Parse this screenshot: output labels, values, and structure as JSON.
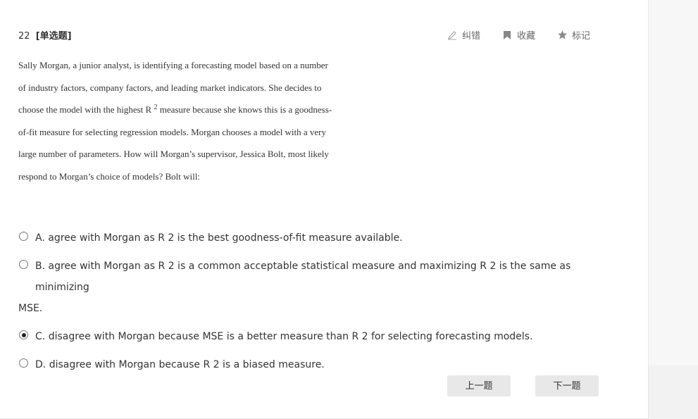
{
  "question": {
    "number": "22",
    "type": "[单选题]",
    "stem_lines": [
      "Sally Morgan, a junior analyst, is identifying a forecasting model based on a number",
      "of industry factors, company factors, and leading market indicators. She decides to",
      "choose the model with the highest R ",
      "2",
      " measure because she knows this is a goodness-",
      "of-fit measure for selecting regression models. Morgan chooses a model with a very",
      "large number of parameters. How will Morgan’s supervisor, Jessica Bolt, most likely",
      "respond to Morgan’s choice of models? Bolt will:"
    ]
  },
  "toolbar": {
    "correct_label": "纠错",
    "favorite_label": "收藏",
    "mark_label": "标记"
  },
  "options": [
    {
      "letter": "A.",
      "text": "agree with Morgan as R 2 is the best goodness-of-fit measure available.",
      "selected": false
    },
    {
      "letter": "B.",
      "text": "agree with Morgan as R 2 is a common acceptable statistical measure and maximizing R 2 is the same as minimizing",
      "text_cont": "MSE.",
      "selected": false
    },
    {
      "letter": "C.",
      "text": "disagree with Morgan because MSE is a better measure than R 2 for selecting forecasting models.",
      "selected": true
    },
    {
      "letter": "D.",
      "text": "disagree with Morgan because R 2 is a biased measure.",
      "selected": false
    }
  ],
  "nav": {
    "prev_label": "上一题",
    "next_label": "下一题"
  },
  "colors": {
    "background": "#f2f2f2",
    "card": "#ffffff",
    "button": "#e8e8e8",
    "icon": "#888888"
  },
  "icons": [
    "pencil-icon",
    "bookmark-icon",
    "star-icon",
    "radio-icon"
  ]
}
